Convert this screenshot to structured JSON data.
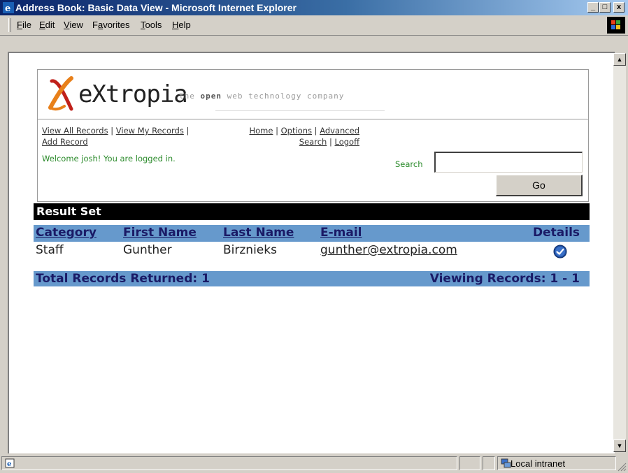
{
  "window": {
    "title": "Address Book: Basic Data View - Microsoft Internet Explorer",
    "min_glyph": "_",
    "max_glyph": "□",
    "close_glyph": "x"
  },
  "menu": [
    {
      "label": "File",
      "underline": "F",
      "rest": "ile"
    },
    {
      "label": "Edit",
      "underline": "E",
      "rest": "dit"
    },
    {
      "label": "View",
      "underline": "V",
      "rest": "iew"
    },
    {
      "label": "Favorites",
      "prefix": "F",
      "underline": "a",
      "rest": "vorites"
    },
    {
      "label": "Tools",
      "underline": "T",
      "rest": "ools"
    },
    {
      "label": "Help",
      "underline": "H",
      "rest": "elp"
    }
  ],
  "logo": {
    "text": "eXtropia",
    "tagline_pre": "the ",
    "tagline_bold": "open",
    "tagline_post": " web technology company"
  },
  "nav": {
    "view_all": "View All Records",
    "view_my": "View My Records",
    "add_record": "Add Record",
    "home": "Home",
    "options": "Options",
    "advanced_search": "Advanced Search",
    "logoff": "Logoff",
    "sep": " | ",
    "welcome": "Welcome josh! You are logged in."
  },
  "search": {
    "label": "Search",
    "value": "",
    "go_label": "Go"
  },
  "results": {
    "title": "Result Set",
    "columns": [
      "Category",
      "First Name",
      "Last Name",
      "E-mail",
      "Details"
    ],
    "rows": [
      {
        "category": "Staff",
        "first_name": "Gunther",
        "last_name": "Birznieks",
        "email": "gunther@extropia.com"
      }
    ],
    "total_label": "Total Records Returned: 1",
    "viewing_label": "Viewing Records: 1 - 1"
  },
  "status": {
    "zone": "Local intranet"
  },
  "colors": {
    "accent_blue": "#6699cc",
    "welcome_green": "#2a8a2a",
    "logo_orange": "#e8801a",
    "logo_red": "#c0201a"
  }
}
